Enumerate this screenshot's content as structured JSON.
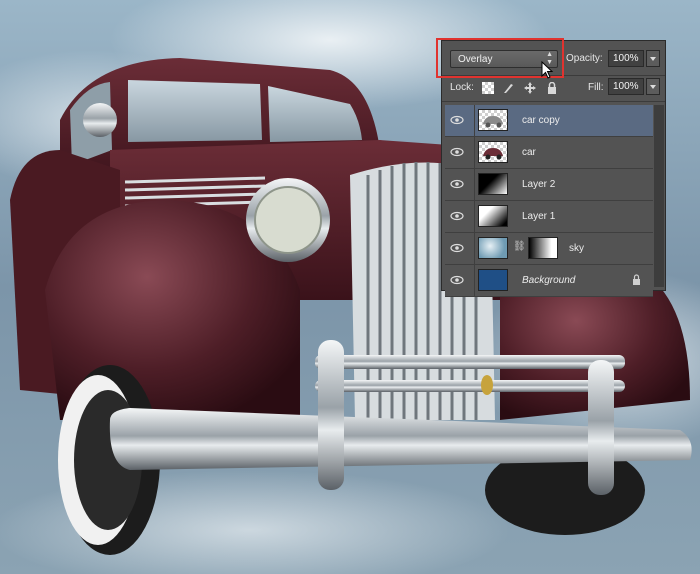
{
  "layers_panel": {
    "blend_mode": "Overlay",
    "opacity_label": "Opacity:",
    "opacity_value": "100%",
    "lock_label": "Lock:",
    "fill_label": "Fill:",
    "fill_value": "100%",
    "layers": [
      {
        "name": "car copy",
        "selected": true
      },
      {
        "name": "car",
        "selected": false
      },
      {
        "name": "Layer 2",
        "selected": false
      },
      {
        "name": "Layer 1",
        "selected": false
      },
      {
        "name": "sky",
        "selected": false
      },
      {
        "name": "Background",
        "selected": false
      }
    ]
  },
  "colors": {
    "panel_bg": "#535353",
    "selected_row": "#5a6a82",
    "highlight_box": "#e0332f",
    "background_layer_fill": "#1f4f86"
  }
}
